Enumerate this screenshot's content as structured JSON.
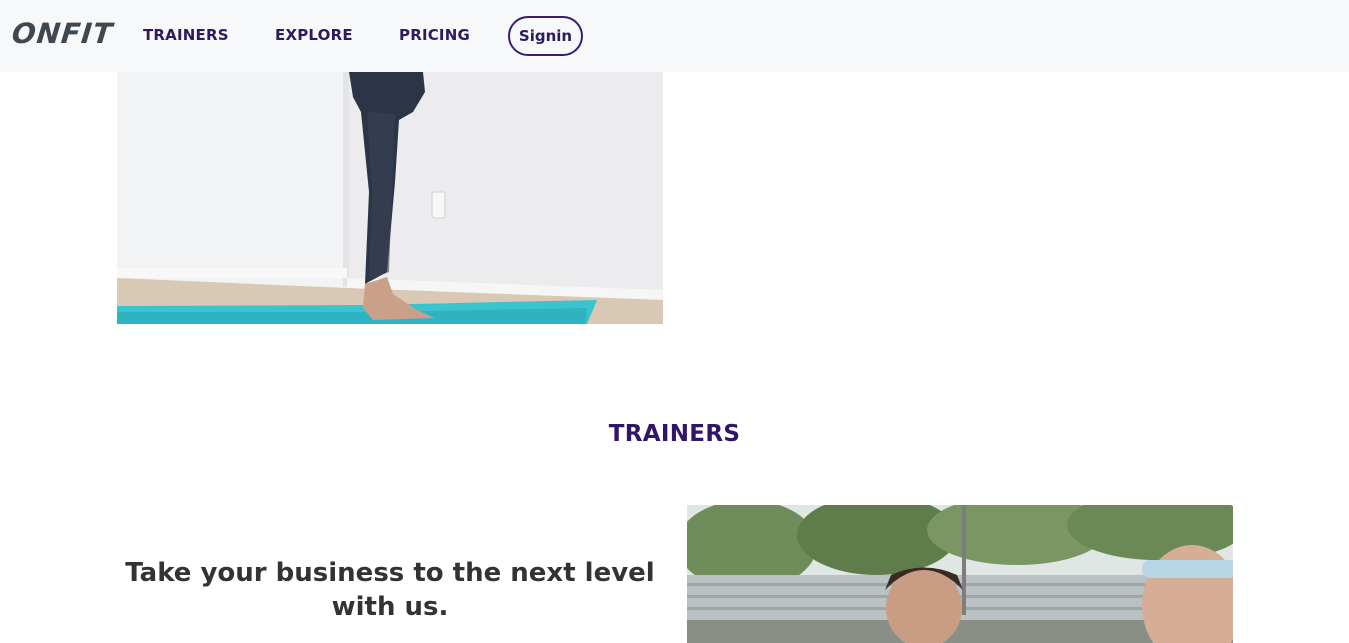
{
  "nav": {
    "logo": "ONFIT",
    "links": [
      "TRAINERS",
      "EXPLORE",
      "PRICING"
    ],
    "signin_label": "Signin"
  },
  "trainers_section": {
    "title": "TRAINERS",
    "pitch": "Take your business to the next level with us."
  },
  "colors": {
    "nav_bg": "#f7f8fa",
    "brand_purple": "#32146b",
    "text_dark": "#333333",
    "logo_gray": "#3f4850"
  }
}
